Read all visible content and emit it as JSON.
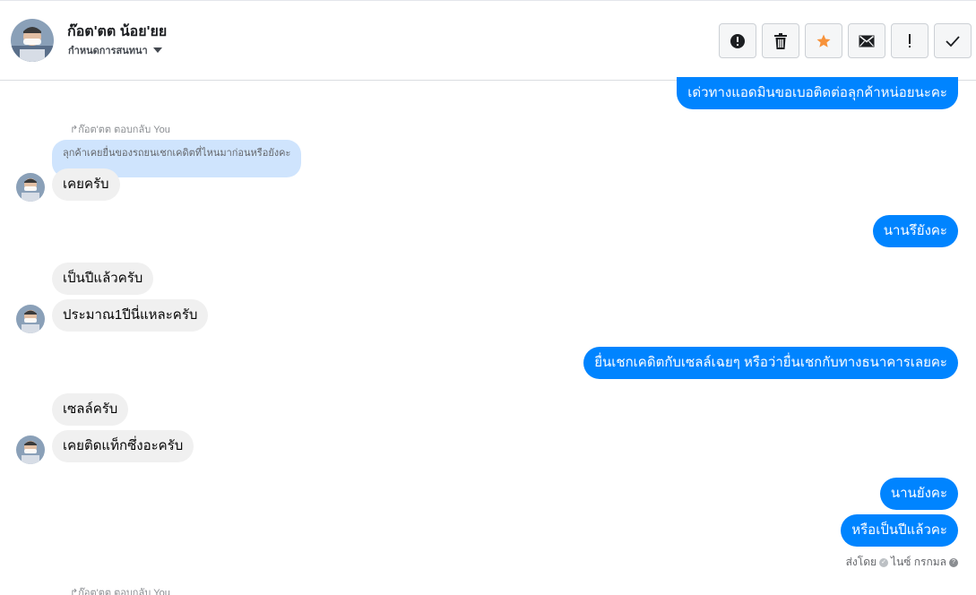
{
  "header": {
    "name": "ก๊อต'ตต น้อย'ยย",
    "subtitle": "กำหนดการสนทนา"
  },
  "toolbar": {
    "buttons": [
      {
        "icon": "alert-circle-icon"
      },
      {
        "icon": "trash-icon"
      },
      {
        "icon": "star-icon",
        "color": "#f7923a"
      },
      {
        "icon": "mail-icon"
      },
      {
        "icon": "exclamation-icon"
      },
      {
        "icon": "checkmark-icon"
      }
    ]
  },
  "messages": {
    "m1": "เด่วทางแอดมินขอเบอติดต่อลุกค้าหน่อยนะคะ",
    "reply_label_1": "ก๊อต'ตต ตอบกลับ You",
    "quoted_1": "ลุกค้าเคยยื่นของรถยนเชกเคดิตที่ไหนมาก่อนหรือยังคะ",
    "m2": "เคยครับ",
    "m3": "นานรึยังคะ",
    "m4": "เป็นปีแล้วครับ",
    "m5": "ประมาณ1ปีนี่แหละครับ",
    "m6": "ยื่นเชกเคดิตกับเซลล์เฉยๆ หรือว่ายื่นเชกกับทางธนาคารเลยคะ",
    "m7": "เซลล์ครับ",
    "m8": "เคยติดแท็กซึ่งอะครับ",
    "m9": "นานยังคะ",
    "m10": "หรือเป็นปีแล้วคะ",
    "reply_label_2": "ก๊อต'ตต ตอบกลับ You"
  },
  "seen": {
    "prefix": "ส่งโดย",
    "name": "ไนซ์ กรกมล",
    "help": "?"
  },
  "colors": {
    "outgoing": "#0084ff",
    "incoming": "#f0f0f0",
    "quoted": "#cfe4fd",
    "star": "#f7923a"
  }
}
